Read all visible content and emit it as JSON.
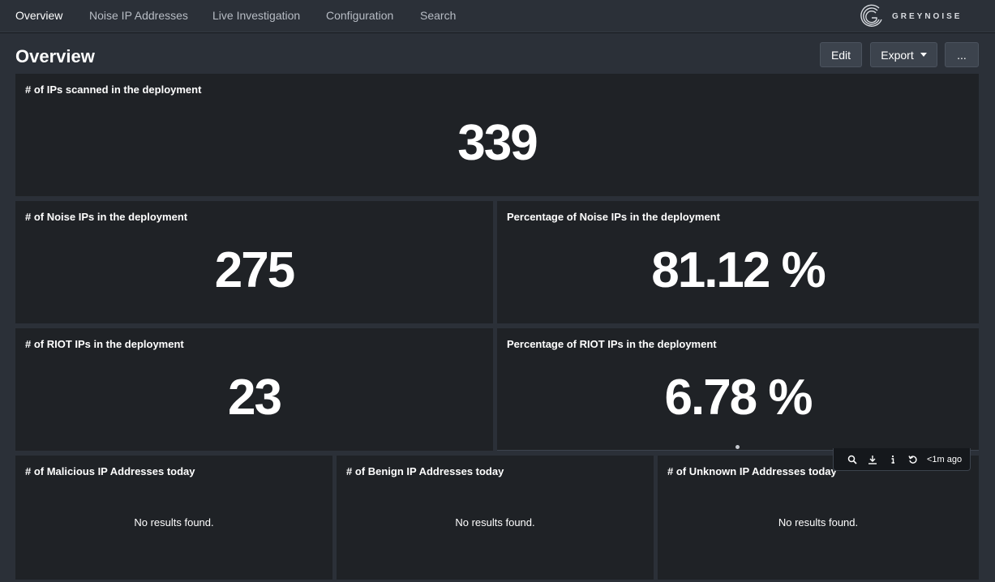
{
  "nav": {
    "items": [
      "Overview",
      "Noise IP Addresses",
      "Live Investigation",
      "Configuration",
      "Search"
    ],
    "brand": "GREYNOISE"
  },
  "header": {
    "title": "Overview",
    "edit_label": "Edit",
    "export_label": "Export",
    "more_label": "..."
  },
  "panels": {
    "ips_scanned": {
      "title": "# of IPs scanned in the deployment",
      "value": "339"
    },
    "noise_ips": {
      "title": "# of Noise IPs in the deployment",
      "value": "275"
    },
    "noise_pct": {
      "title": "Percentage of Noise IPs in the deployment",
      "value": "81.12 %"
    },
    "riot_ips": {
      "title": "# of RIOT IPs in the deployment",
      "value": "23"
    },
    "riot_pct": {
      "title": "Percentage of RIOT IPs in the deployment",
      "value": "6.78 %"
    },
    "malicious": {
      "title": "# of Malicious IP Addresses today",
      "value": "No results found."
    },
    "benign": {
      "title": "# of Benign IP Addresses today",
      "value": "No results found."
    },
    "unknown": {
      "title": "# of Unknown IP Addresses today",
      "value": "No results found."
    }
  },
  "panel_toolbar": {
    "icons": [
      "search-icon",
      "download-icon",
      "info-icon",
      "refresh-icon"
    ],
    "last_updated": "<1m ago"
  }
}
